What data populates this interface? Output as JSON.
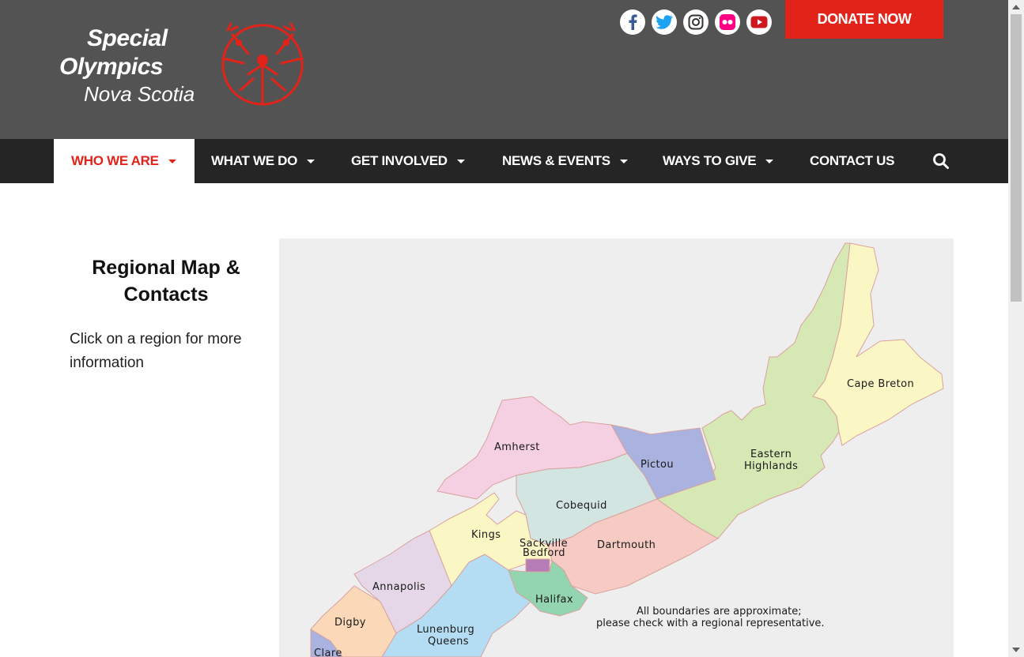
{
  "header": {
    "logo": {
      "line1": "Special",
      "line2": "Olympics",
      "line3": "Nova Scotia"
    },
    "social": [
      "facebook-icon",
      "twitter-icon",
      "instagram-icon",
      "flickr-icon",
      "youtube-icon"
    ],
    "donate_label": "DONATE NOW",
    "colors": {
      "header_bg": "#535353",
      "accent": "#e2231a",
      "nav_bg": "#252525"
    }
  },
  "nav": {
    "items": [
      {
        "label": "WHO WE ARE"
      },
      {
        "label": "WHAT WE DO"
      },
      {
        "label": "GET INVOLVED"
      },
      {
        "label": "NEWS & EVENTS"
      },
      {
        "label": "WAYS TO GIVE"
      },
      {
        "label": "CONTACT US"
      }
    ],
    "search_icon": "search-icon"
  },
  "sidebar": {
    "title": "Regional Map & Contacts",
    "text": "Click on a region for more information"
  },
  "map": {
    "regions": {
      "cape_breton": "Cape Breton",
      "eastern_highlands_1": "Eastern",
      "eastern_highlands_2": "Highlands",
      "amherst": "Amherst",
      "pictou": "Pictou",
      "cobequid": "Cobequid",
      "kings": "Kings",
      "sackville_1": "Sackville",
      "sackville_2": "Bedford",
      "dartmouth": "Dartmouth",
      "annapolis": "Annapolis",
      "halifax": "Halifax",
      "digby": "Digby",
      "lunenburg_1": "Lunenburg",
      "lunenburg_2": "Queens",
      "clare": "Clare"
    },
    "note_line1": "All boundaries are approximate;",
    "note_line2": "please check with a regional representative."
  }
}
